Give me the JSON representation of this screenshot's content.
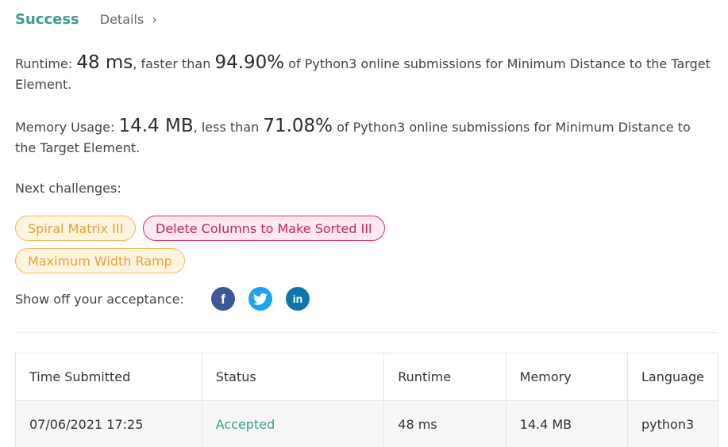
{
  "header": {
    "success_label": "Success",
    "details_label": "Details",
    "details_chevron": "›"
  },
  "runtime_stat": {
    "prefix": "Runtime: ",
    "value": "48 ms",
    "middle": ", faster than ",
    "percent": "94.90%",
    "suffix": " of Python3 online submissions for Minimum Distance to the Target Element."
  },
  "memory_stat": {
    "prefix": "Memory Usage: ",
    "value": "14.4 MB",
    "middle": ", less than ",
    "percent": "71.08%",
    "suffix": " of Python3 online submissions for Minimum Distance to the Target Element."
  },
  "next_challenges": {
    "label": "Next challenges:",
    "items": [
      {
        "label": "Spiral Matrix III",
        "difficulty_color": "#f5b85a"
      },
      {
        "label": "Delete Columns to Make Sorted III",
        "difficulty_color": "#d8316a"
      },
      {
        "label": "Maximum Width Ramp",
        "difficulty_color": "#f5b85a"
      }
    ]
  },
  "share": {
    "label": "Show off your acceptance:",
    "icons": [
      "facebook-icon",
      "twitter-icon",
      "linkedin-icon"
    ],
    "facebook_glyph": "f",
    "linkedin_glyph": "in"
  },
  "submissions": {
    "columns": [
      "Time Submitted",
      "Status",
      "Runtime",
      "Memory",
      "Language"
    ],
    "rows": [
      [
        "07/06/2021 17:25",
        "Accepted",
        "48 ms",
        "14.4 MB",
        "python3"
      ]
    ]
  },
  "colors": {
    "accent": "#3f9c8a",
    "medium": "#f5b85a",
    "hard": "#d8316a"
  }
}
